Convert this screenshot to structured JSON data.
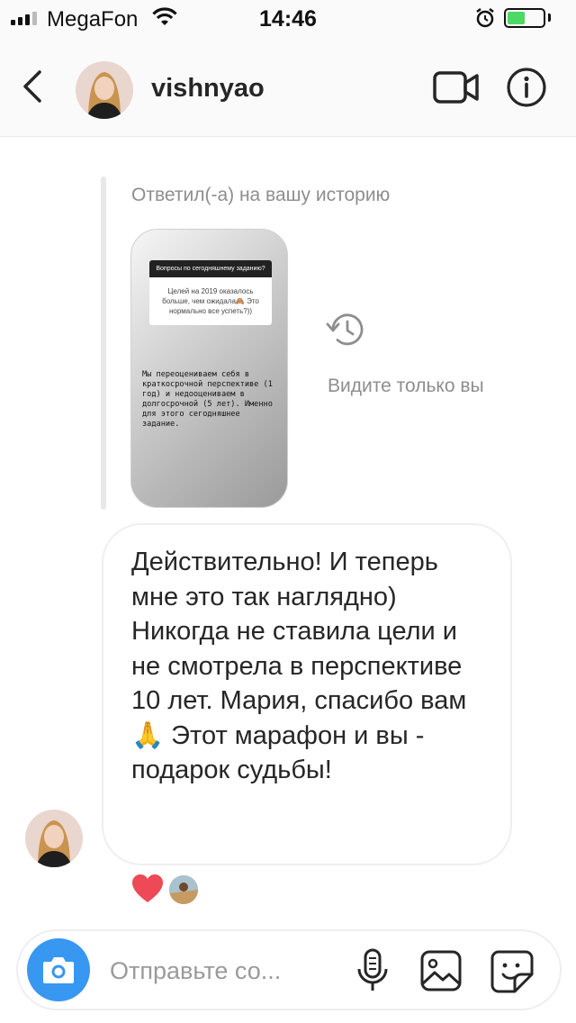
{
  "status_bar": {
    "carrier": "MegaFon",
    "time": "14:46",
    "battery_level": 0.5,
    "battery_color": "#4cd964"
  },
  "header": {
    "username": "vishnyao",
    "icons": [
      "back-chevron-icon",
      "video-call-icon",
      "info-icon"
    ]
  },
  "story_reply": {
    "label": "Ответил(-а) на вашу историю",
    "question_header": "Вопросы по сегодняшнему заданию?",
    "question_text": "Целей на 2019 оказалось больше, чем ожидала🙈 Это нормально все успеть?))",
    "story_text": "Мы переоцениваем себя в краткосрочной перспективе (1 год) и недооцениваем в долгосрочной (5 лет). Именно для этого сегодняшнее задание.",
    "visibility_note": "Видите только вы"
  },
  "message": {
    "text": "Действительно! И теперь мне это так наглядно) Никогда не ставила цели и не смотрела в перспективе 10 лет. Мария, спасибо вам🙏 Этот марафон и вы - подарок судьбы!"
  },
  "reactions": {
    "icons": [
      "heart-icon"
    ],
    "heart_color": "#ed4956"
  },
  "composer": {
    "placeholder": "Отправьте со...",
    "accent_color": "#3897f0",
    "icons": [
      "camera-icon",
      "microphone-icon",
      "gallery-icon",
      "sticker-icon"
    ]
  }
}
